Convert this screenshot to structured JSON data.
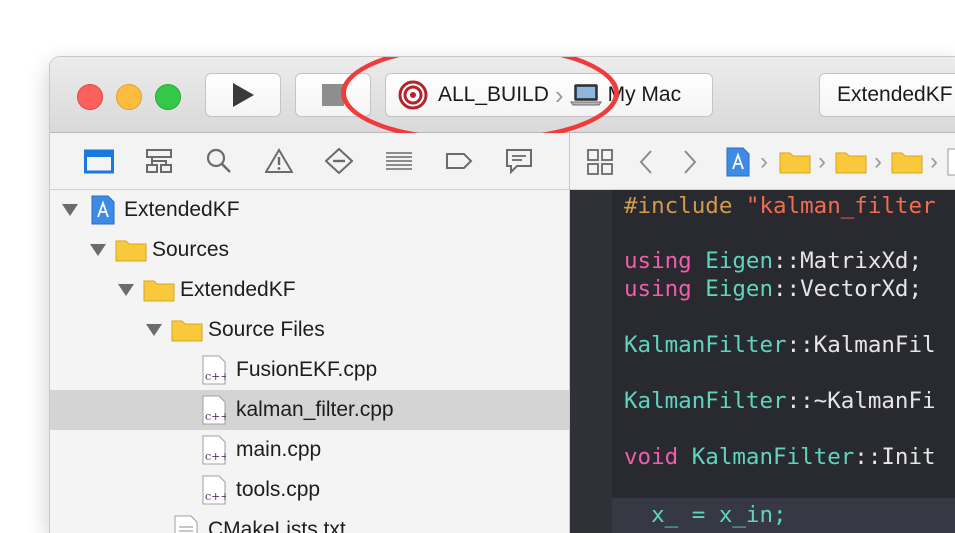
{
  "toolbar": {
    "scheme_target": "ALL_BUILD",
    "scheme_destination": "My Mac",
    "status_text": "ExtendedKF",
    "run_icon": "play-icon",
    "stop_icon": "stop-icon"
  },
  "navigator_icons": [
    "folder-icon",
    "hierarchy-icon",
    "search-icon",
    "warning-icon",
    "test-icon",
    "debug-icon",
    "breakpoint-icon",
    "report-icon"
  ],
  "jump_bar_icons": [
    "grid-icon",
    "chevron-left-icon",
    "chevron-right-icon",
    "project-icon",
    "folder-icon"
  ],
  "tree": [
    {
      "label": "ExtendedKF",
      "icon": "project-icon",
      "depth": 0,
      "expanded": true
    },
    {
      "label": "Sources",
      "icon": "folder-icon",
      "depth": 1,
      "expanded": true
    },
    {
      "label": "ExtendedKF",
      "icon": "folder-icon",
      "depth": 2,
      "expanded": true
    },
    {
      "label": "Source Files",
      "icon": "folder-icon",
      "depth": 3,
      "expanded": true
    },
    {
      "label": "FusionEKF.cpp",
      "icon": "cpp-file-icon",
      "depth": 4
    },
    {
      "label": "kalman_filter.cpp",
      "icon": "cpp-file-icon",
      "depth": 4,
      "selected": true
    },
    {
      "label": "main.cpp",
      "icon": "cpp-file-icon",
      "depth": 4
    },
    {
      "label": "tools.cpp",
      "icon": "cpp-file-icon",
      "depth": 4
    },
    {
      "label": "CMakeLists.txt",
      "icon": "text-file-icon",
      "depth": 3
    }
  ],
  "code_lines": [
    [
      {
        "t": "#include ",
        "c": "pp"
      },
      {
        "t": "\"kalman_filter",
        "c": "str"
      }
    ],
    [],
    [
      {
        "t": "using ",
        "c": "kw"
      },
      {
        "t": "Eigen",
        "c": "ty"
      },
      {
        "t": "::MatrixXd;",
        "c": "pl"
      }
    ],
    [
      {
        "t": "using ",
        "c": "kw"
      },
      {
        "t": "Eigen",
        "c": "ty"
      },
      {
        "t": "::VectorXd;",
        "c": "pl"
      }
    ],
    [],
    [
      {
        "t": "KalmanFilter",
        "c": "ty"
      },
      {
        "t": "::KalmanFil",
        "c": "pl"
      }
    ],
    [],
    [
      {
        "t": "KalmanFilter",
        "c": "ty"
      },
      {
        "t": "::~KalmanFi",
        "c": "pl"
      }
    ],
    [],
    [
      {
        "t": "void ",
        "c": "kw"
      },
      {
        "t": "KalmanFilter",
        "c": "ty"
      },
      {
        "t": "::Init",
        "c": "pl"
      }
    ],
    [],
    [
      {
        "t": "  x_ = x_in;",
        "c": "ty2"
      }
    ]
  ],
  "colors": {
    "accent_red": "#ef3b3b",
    "editor_bg": "#292a30",
    "keyword": "#f15daa",
    "type": "#5fd5c0",
    "string": "#f26c4f"
  }
}
